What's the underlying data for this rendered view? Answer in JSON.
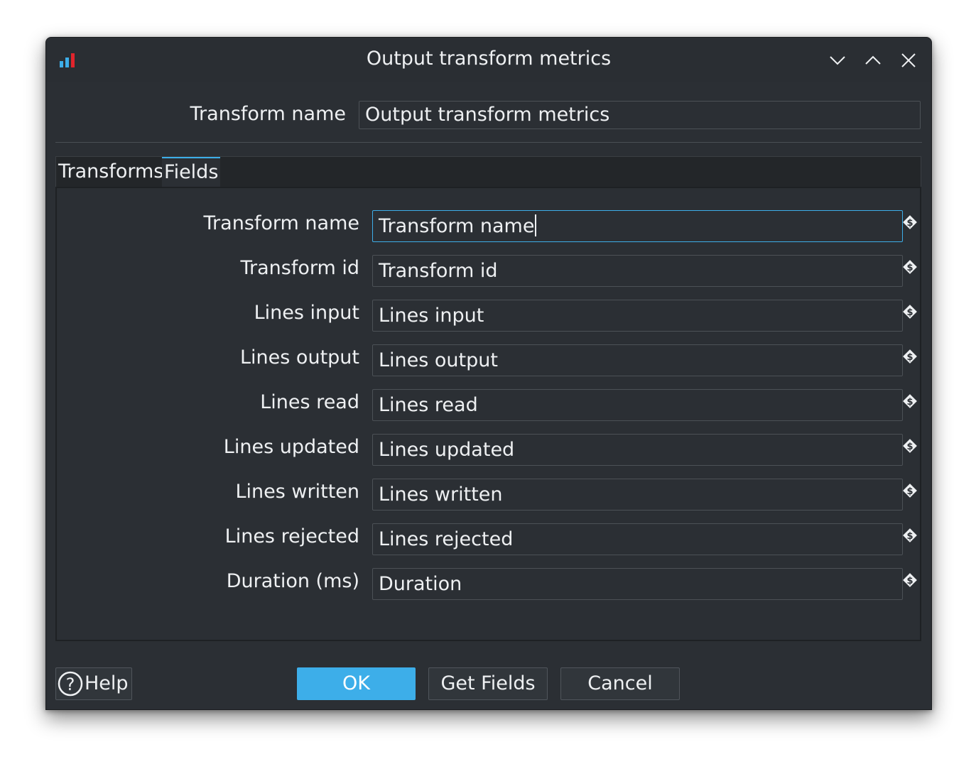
{
  "window": {
    "title": "Output transform metrics",
    "controls": [
      "chevron-down-icon",
      "chevron-up-icon",
      "close-icon"
    ]
  },
  "header": {
    "transform_name_label": "Transform name",
    "transform_name_value": "Output transform metrics"
  },
  "tabs": [
    {
      "label": "Transforms",
      "active": false
    },
    {
      "label": "Fields",
      "active": true
    }
  ],
  "fields": [
    {
      "label": "Transform name",
      "value": "Transform name",
      "focused": true
    },
    {
      "label": "Transform id",
      "value": "Transform id"
    },
    {
      "label": "Lines input",
      "value": "Lines input"
    },
    {
      "label": "Lines output",
      "value": "Lines output"
    },
    {
      "label": "Lines read",
      "value": "Lines read"
    },
    {
      "label": "Lines updated",
      "value": "Lines updated"
    },
    {
      "label": "Lines written",
      "value": "Lines written"
    },
    {
      "label": "Lines rejected",
      "value": "Lines rejected"
    },
    {
      "label": "Duration (ms)",
      "value": "Duration"
    }
  ],
  "buttons": {
    "help": "Help",
    "ok": "OK",
    "get_fields": "Get Fields",
    "cancel": "Cancel"
  },
  "colors": {
    "accent": "#3daee9",
    "window_bg": "#2b2f34",
    "icon_bar_blue": "#3daee9",
    "icon_bar_red": "#e0242c"
  }
}
